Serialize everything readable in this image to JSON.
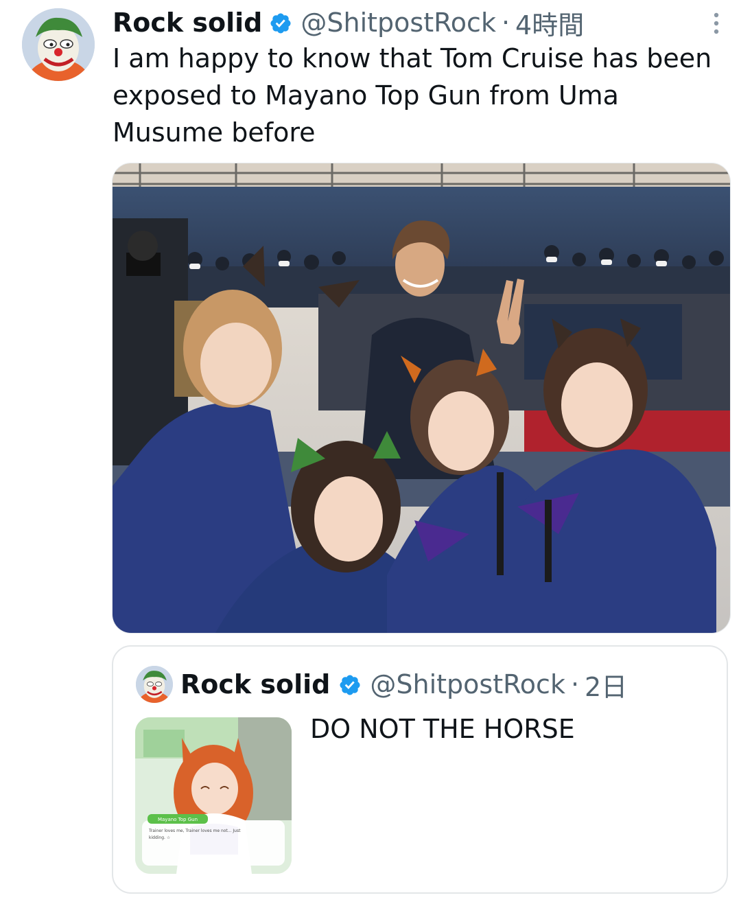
{
  "tweet": {
    "display_name": "Rock solid",
    "handle": "@ShitpostRock",
    "separator": "·",
    "time": "4時間",
    "text": "I am happy to know that Tom Cruise has been exposed to Mayano Top Gun from Uma Musume before",
    "verified_icon": "verified-badge-icon",
    "more_icon": "more-vertical-icon"
  },
  "quoted": {
    "display_name": "Rock solid",
    "handle": "@ShitpostRock",
    "separator": "·",
    "time": "2日",
    "text": "DO NOT THE HORSE",
    "thumbnail": {
      "dialog_name": "Mayano Top Gun",
      "dialog_line1": "Trainer loves me, Trainer loves me not... Just",
      "dialog_line2": "kidding. ☆"
    }
  },
  "colors": {
    "verified_blue": "#1d9bf0",
    "secondary_text": "#536471",
    "primary_text": "#0f1419",
    "card_border": "#e3e6e8"
  }
}
